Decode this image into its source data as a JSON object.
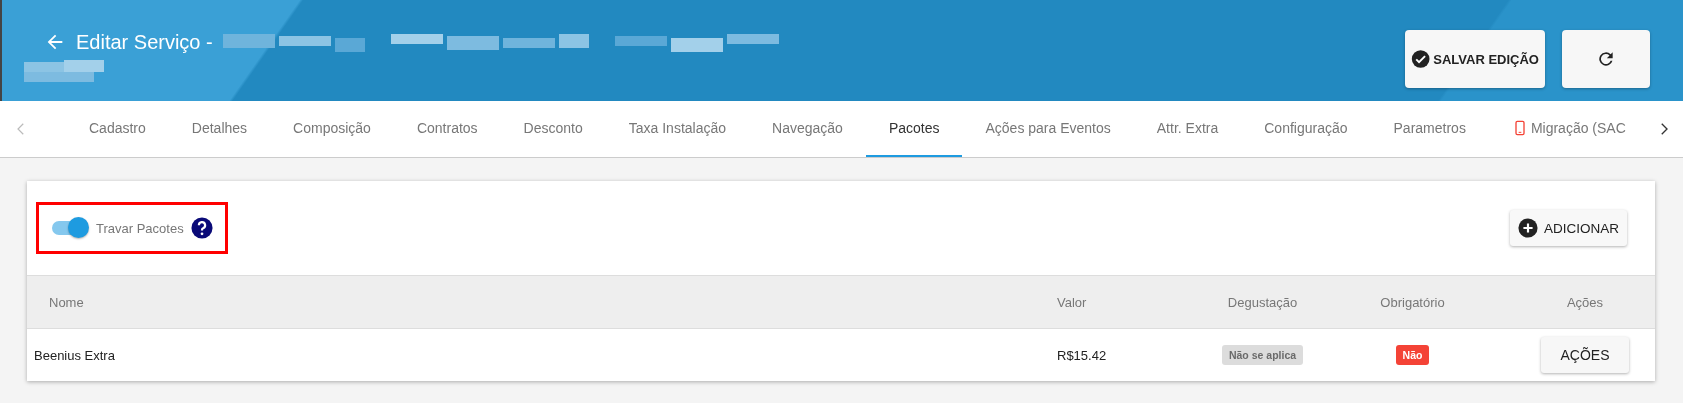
{
  "header": {
    "title": "Editar Serviço -",
    "buttons": [
      {
        "kind": "save",
        "label": "SALVAR EDIÇÃO"
      },
      {
        "kind": "refresh"
      }
    ]
  },
  "tabs": [
    {
      "label": "Cadastro",
      "selected": false
    },
    {
      "label": "Detalhes",
      "selected": false
    },
    {
      "label": "Composição",
      "selected": false
    },
    {
      "label": "Contratos",
      "selected": false
    },
    {
      "label": "Desconto",
      "selected": false
    },
    {
      "label": "Taxa Instalação",
      "selected": false
    },
    {
      "label": "Navegação",
      "selected": false
    },
    {
      "label": "Pacotes",
      "selected": true
    },
    {
      "label": "Ações para Eventos",
      "selected": false
    },
    {
      "label": "Attr. Extra",
      "selected": false
    },
    {
      "label": "Configuração",
      "selected": false
    },
    {
      "label": "Parametros",
      "selected": false
    },
    {
      "label": "Migração (SAC",
      "selected": false,
      "kind": "phone"
    }
  ],
  "lock_toggle": {
    "label": "Travar Pacotes",
    "on": true,
    "highlighted": true
  },
  "add_button": "ADICIONAR",
  "table": {
    "columns": [
      "Nome",
      "Valor",
      "Degustação",
      "Obrigatório",
      "Ações"
    ],
    "rows": [
      {
        "name": "Beenius Extra",
        "value": "R$15.42",
        "tasting": {
          "label": "Não se aplica",
          "kind": "neutral"
        },
        "required": {
          "label": "Não",
          "kind": "no"
        },
        "action": "AÇÕES"
      }
    ]
  }
}
